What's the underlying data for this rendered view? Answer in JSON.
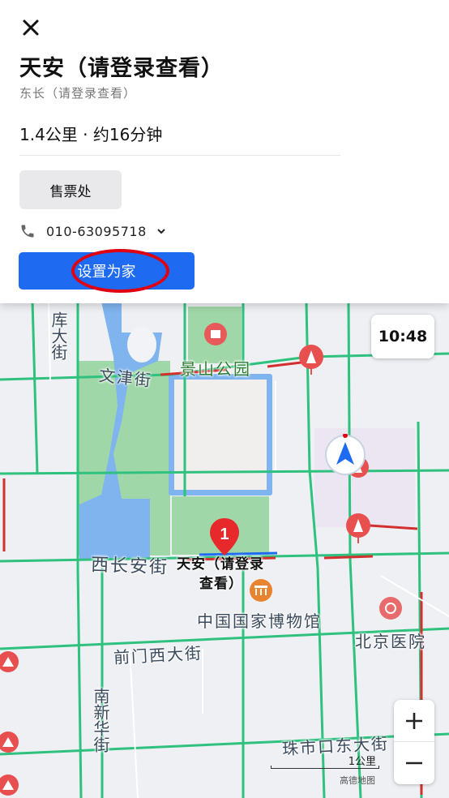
{
  "card": {
    "close_icon": "close-icon",
    "title": "天安（请登录查看）",
    "subtitle": "东长（请登录查看）",
    "distance": "1.4公里 · 约16分钟",
    "ticket_label": "售票处",
    "phone": "010-63095718",
    "home_label": "设置为家"
  },
  "map": {
    "labels": {
      "ku_da_jie": "库大街",
      "wen_jin_jie": "文津街",
      "jing_shan": "景山公园",
      "xi_chang_an": "西长安街",
      "poi_title_line1": "天安（请登录",
      "poi_title_line2": "查看）",
      "museum": "中国国家博物馆",
      "qianmen": "前门西大街",
      "beijing_hospital": "北京医院",
      "nan_xin_hua": "南新华街",
      "zhushikou": "珠市口东大街"
    },
    "marker_number": "1",
    "time": "10:48",
    "scale": "1公里",
    "watermark": "高德地图"
  },
  "colors": {
    "accent": "#1e6bf2",
    "highlight": "#e0000f",
    "road_green": "#2ec27e",
    "road_red": "#d32f2f",
    "water": "#7fb4ef",
    "park": "#9fd7a8",
    "palace": "#f1eeee"
  }
}
